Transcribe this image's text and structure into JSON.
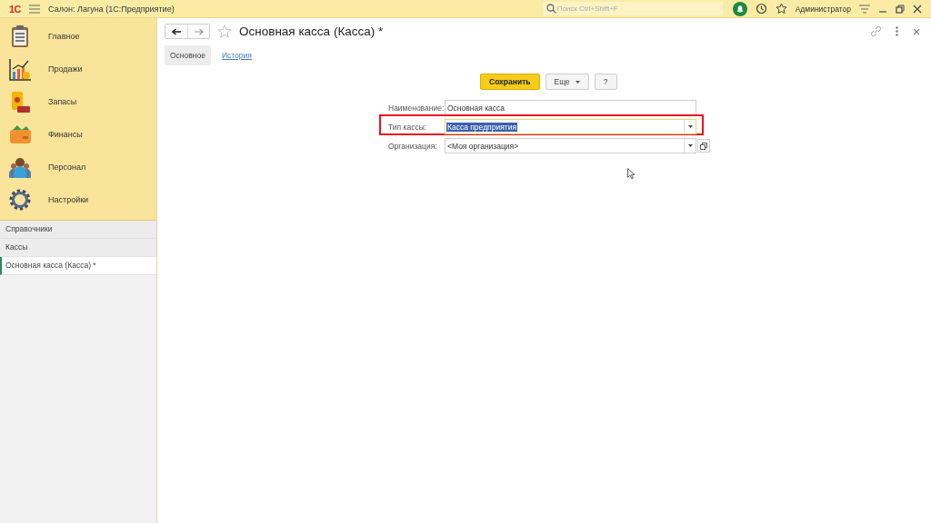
{
  "app_bar": {
    "logo": "1С",
    "title": "Салон: Лагуна  (1С:Предприятие)",
    "search": {
      "placeholder": "Поиск Ctrl+Shift+F"
    },
    "user": "Администратор"
  },
  "sections": [
    {
      "kind": "clipboard",
      "label": "Главное"
    },
    {
      "kind": "chart",
      "label": "Продажи"
    },
    {
      "kind": "stock",
      "label": "Запасы"
    },
    {
      "kind": "wallet",
      "label": "Финансы"
    },
    {
      "kind": "people",
      "label": "Персонал"
    },
    {
      "kind": "gear",
      "label": "Настройки"
    }
  ],
  "open_windows": [
    {
      "label": "Справочники",
      "selected": false
    },
    {
      "label": "Кассы",
      "selected": false
    },
    {
      "label": "Основная касса (Касса) *",
      "selected": true
    }
  ],
  "form": {
    "title": "Основная касса (Касса) *",
    "tabs": [
      {
        "label": "Основное",
        "selected": true
      },
      {
        "label": "История",
        "selected": false
      }
    ],
    "buttons": [
      {
        "kind": "primary",
        "label": "Сохранить"
      },
      {
        "kind": "menu",
        "label": "Еще"
      },
      {
        "kind": "plain",
        "label": "?"
      }
    ],
    "fields": [
      {
        "label": "Наименование:",
        "value": "Основная касса",
        "kind": "text",
        "highlighted": false,
        "focused": false
      },
      {
        "label": "Тип кассы:",
        "value": "Касса предприятия",
        "kind": "select",
        "highlighted": true,
        "focused": true
      },
      {
        "label": "Организация:",
        "value": "<Моя организация>",
        "kind": "select-open",
        "highlighted": false,
        "focused": false
      }
    ]
  }
}
